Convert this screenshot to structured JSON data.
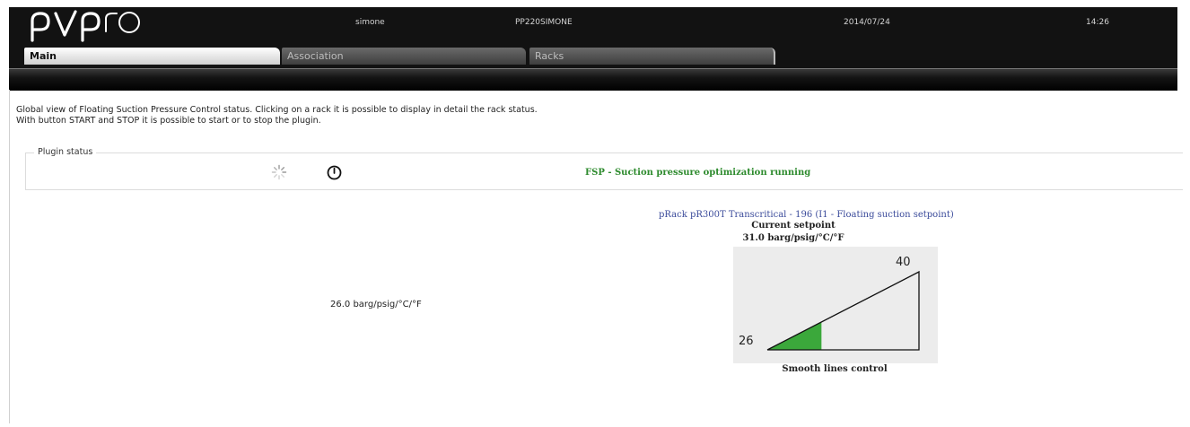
{
  "header": {
    "logo_text": "pvpro",
    "user": "simone",
    "device": "PP220SIMONE",
    "date": "2014/07/24",
    "time": "14:26"
  },
  "tabs": [
    {
      "label": "Main",
      "active": true
    },
    {
      "label": "Association",
      "active": false
    },
    {
      "label": "Racks",
      "active": false
    }
  ],
  "description": {
    "line1": "Global view of Floating Suction Pressure Control status. Clicking on a rack it is possible to display in detail the rack status.",
    "line2": "With button START and STOP it is possible to start or to stop the plugin."
  },
  "plugin_status": {
    "legend": "Plugin status",
    "spinner_icon": "spinner-icon",
    "power_icon": "power-icon",
    "status_text": "FSP - Suction pressure optimization running",
    "status_color": "#2e8b2e"
  },
  "rack": {
    "value_text": "26.0 barg/psig/°C/°F",
    "title": "pRack pR300T Transcritical - 196 (I1 - Floating suction setpoint)",
    "setpoint_label": "Current setpoint",
    "setpoint_value": "31.0 barg/psig/°C/°F",
    "control_label": "Smooth lines control"
  },
  "setpoint_chart": {
    "min_label": "26",
    "max_label": "40",
    "min": 26,
    "max": 40,
    "current": 31,
    "fill_color": "#3ba83b"
  }
}
